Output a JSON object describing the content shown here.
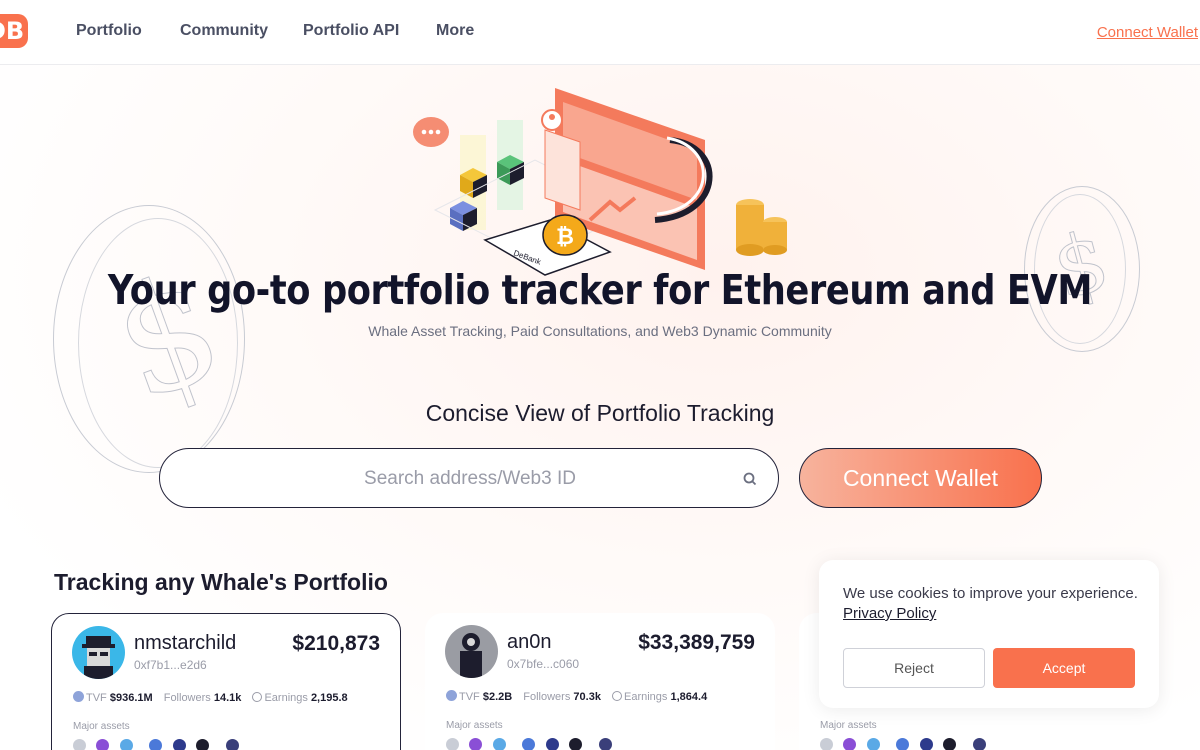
{
  "nav": {
    "logo": "DB",
    "items": [
      "Portfolio",
      "Community",
      "Portfolio API",
      "More"
    ],
    "connect_wallet": "Connect Wallet"
  },
  "hero": {
    "title": "Your go-to portfolio tracker for Ethereum and EVM",
    "subtitle": "Whale Asset Tracking, Paid Consultations, and Web3 Dynamic Community",
    "brand_label": "DeBank"
  },
  "tracking": {
    "title": "Concise View of Portfolio Tracking",
    "search_placeholder": "Search address/Web3 ID",
    "connect_button": "Connect Wallet"
  },
  "whales": {
    "title": "Tracking any Whale's Portfolio",
    "labels": {
      "tvf": "TVF",
      "followers": "Followers",
      "earnings": "Earnings",
      "major_assets": "Major assets"
    },
    "cards": [
      {
        "name": "nmstarchild",
        "address": "0xf7b1...e2d6",
        "value": "$210,873",
        "tvf": "$936.1M",
        "followers": "14.1k",
        "earnings": "2,195.8"
      },
      {
        "name": "an0n",
        "address": "0x7bfe...c060",
        "value": "$33,389,759",
        "tvf": "$2.2B",
        "followers": "70.3k",
        "earnings": "1,864.4"
      }
    ]
  },
  "cookie": {
    "text": "We use cookies to improve your experience.",
    "link": "Privacy Policy",
    "reject": "Reject",
    "accept": "Accept"
  },
  "colors": {
    "accent": "#f9714d",
    "dark": "#1c1c2e",
    "muted": "#9a9ca8"
  }
}
